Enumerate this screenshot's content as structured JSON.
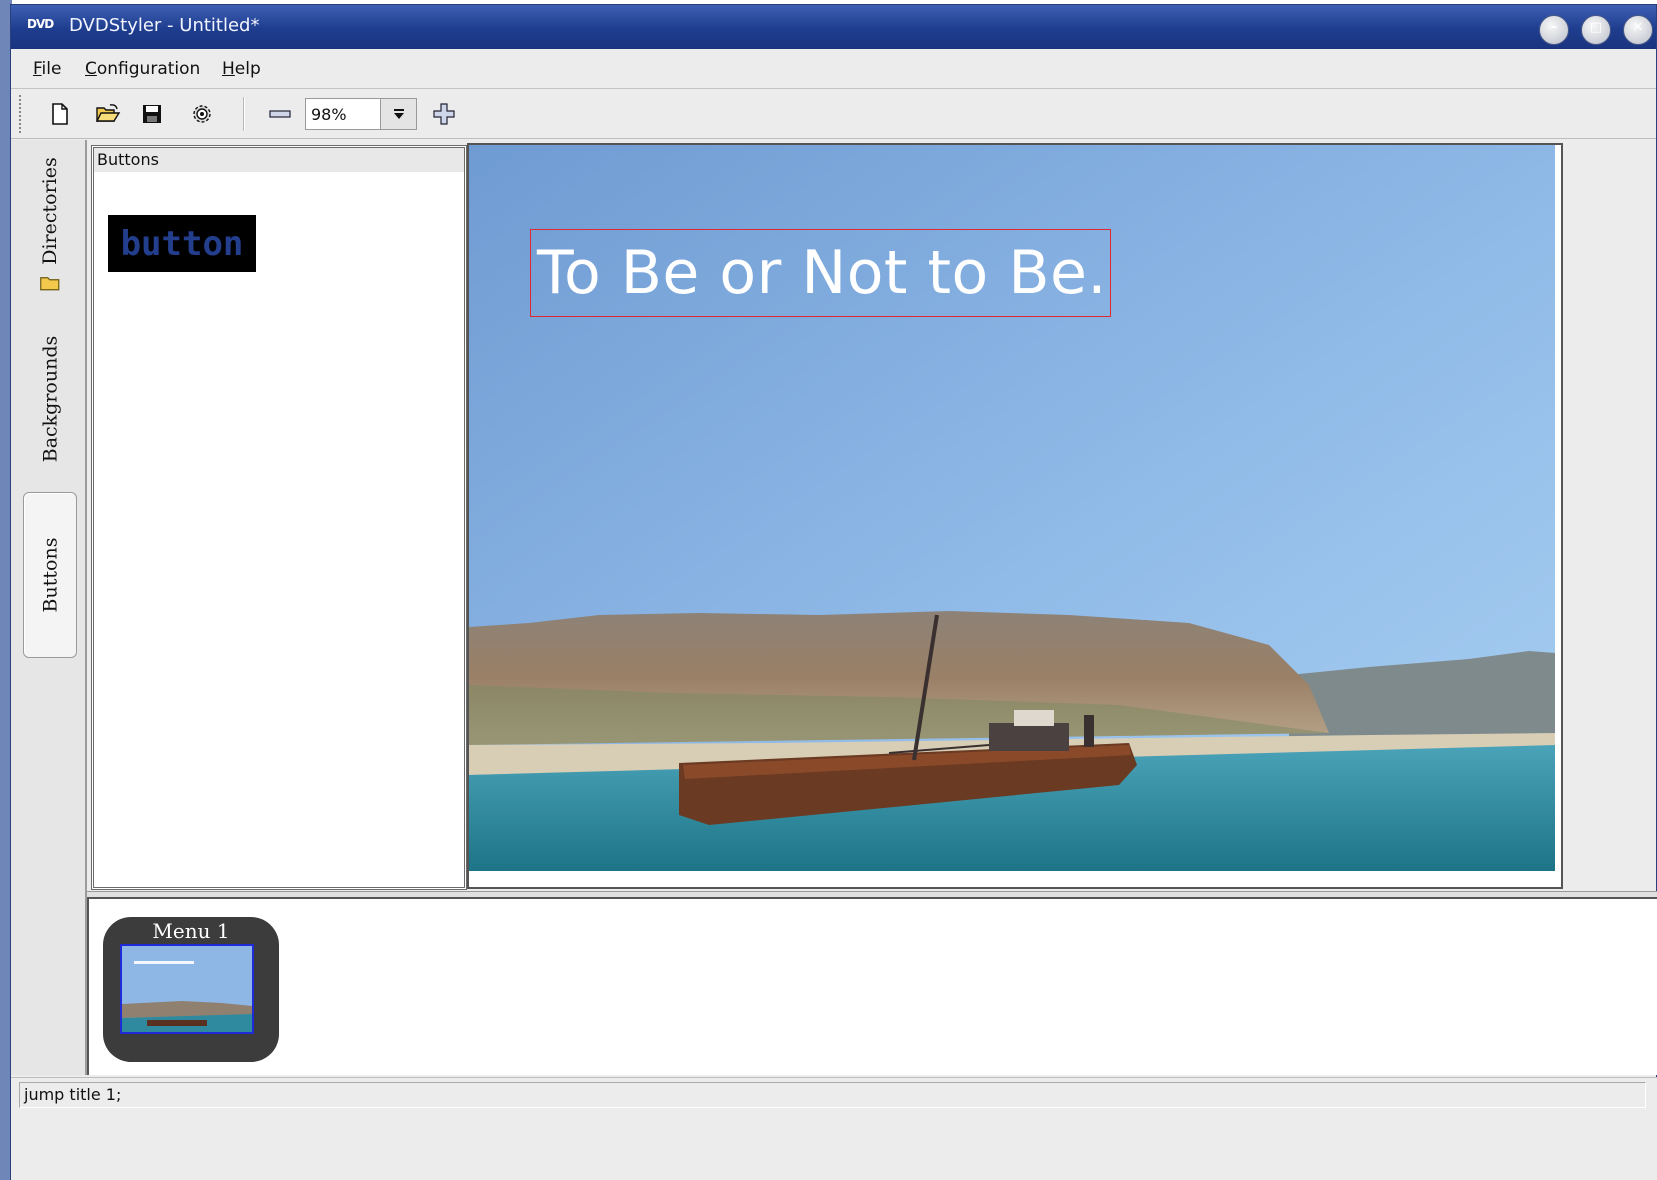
{
  "window": {
    "title": "DVDStyler - Untitled*",
    "app_icon_text": "DVD"
  },
  "menubar": {
    "file": {
      "underline": "F",
      "rest": "ile"
    },
    "configuration": {
      "underline": "C",
      "rest": "onfiguration"
    },
    "help": {
      "underline": "H",
      "rest": "elp"
    }
  },
  "toolbar": {
    "new_icon": "new-document-icon",
    "open_icon": "open-folder-icon",
    "save_icon": "save-disk-icon",
    "settings_icon": "settings-gear-icon",
    "zoom_out_icon": "minus-icon",
    "zoom_value": "98%",
    "zoom_in_icon": "plus-icon"
  },
  "side_tabs": {
    "directories": "Directories",
    "backgrounds": "Backgrounds",
    "buttons": "Buttons",
    "active": "Buttons"
  },
  "buttons_panel": {
    "header": "Buttons",
    "sample_button_text": "button"
  },
  "canvas": {
    "text_object": "To Be or Not to Be.",
    "selection_color": "#e0282f"
  },
  "menus": {
    "items": [
      {
        "label": "Menu 1"
      }
    ]
  },
  "statusbar": {
    "text": "jump title 1;"
  },
  "colors": {
    "titlebar": "#1f3d8e",
    "button_text": "#243e8e",
    "thumbnail_border": "#1e2bd6"
  }
}
